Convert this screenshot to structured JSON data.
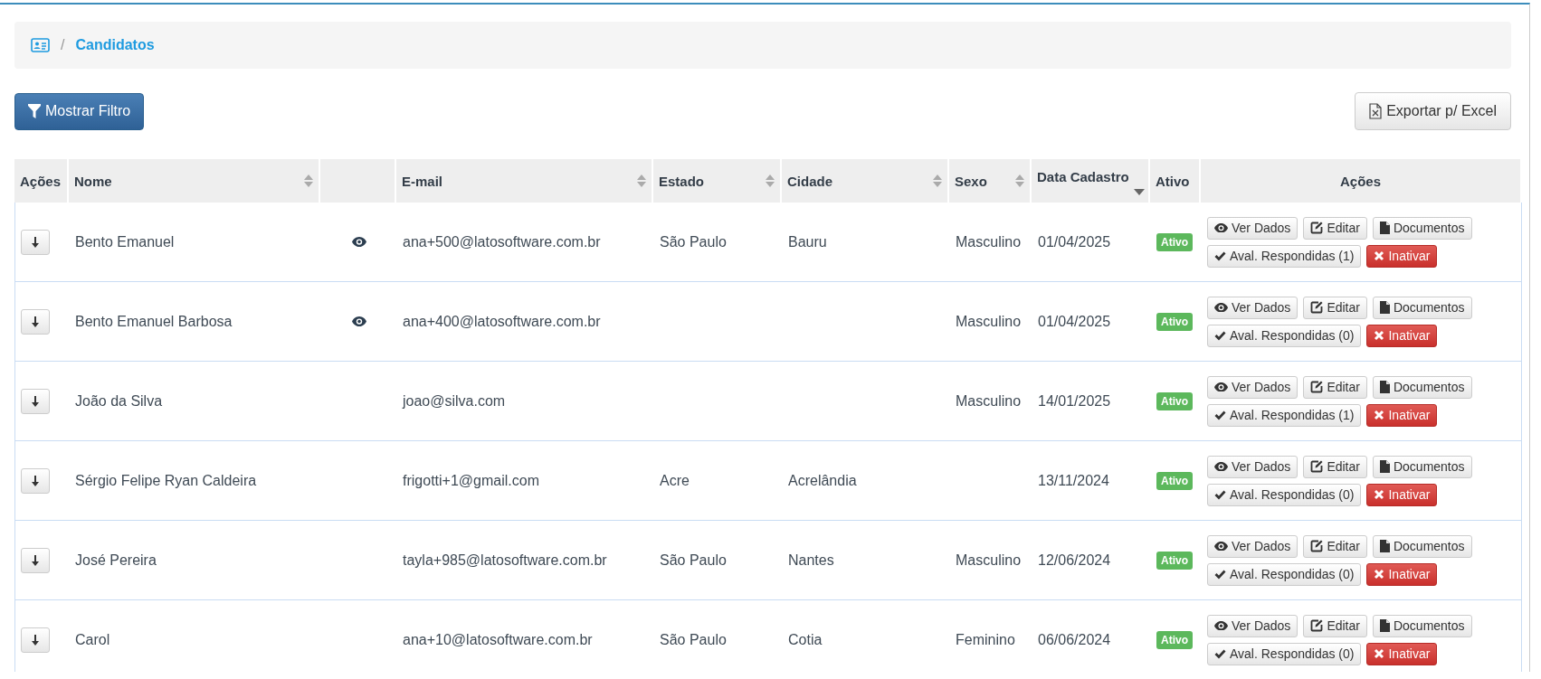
{
  "breadcrumb": {
    "separator": "/",
    "current": "Candidatos"
  },
  "toolbar": {
    "filter_button": "Mostrar Filtro",
    "export_button": "Exportar p/ Excel"
  },
  "table": {
    "columns": [
      {
        "label": "Ações",
        "sortable": false
      },
      {
        "label": "Nome",
        "sortable": true,
        "sorted_desc": false
      },
      {
        "sortable": false
      },
      {
        "label": "E-mail",
        "sortable": true,
        "sorted_desc": false
      },
      {
        "label": "Estado",
        "sortable": true,
        "sorted_desc": false
      },
      {
        "label": "Cidade",
        "sortable": true,
        "sorted_desc": false
      },
      {
        "label": "Sexo",
        "sortable": true,
        "sorted_desc": false
      },
      {
        "label": "Data Cadastro",
        "sortable": true,
        "sorted_desc": true
      },
      {
        "label": "Ativo",
        "sortable": false
      },
      {
        "label": "Ações",
        "sortable": false
      }
    ],
    "rows": [
      {
        "name": "Bento Emanuel",
        "viewed": true,
        "email": "ana+500@latosoftware.com.br",
        "estado": "São Paulo",
        "cidade": "Bauru",
        "sexo": "Masculino",
        "data": "01/04/2025",
        "status": "Ativo",
        "active": true,
        "actions": {
          "view": "Ver Dados",
          "edit": "Editar",
          "docs": "Documentos",
          "answered": "Aval. Respondidas (1)",
          "deactivate": "Inativar"
        }
      },
      {
        "name": "Bento Emanuel Barbosa",
        "viewed": true,
        "email": "ana+400@latosoftware.com.br",
        "estado": "",
        "cidade": "",
        "sexo": "Masculino",
        "data": "01/04/2025",
        "status": "Ativo",
        "active": true,
        "actions": {
          "view": "Ver Dados",
          "edit": "Editar",
          "docs": "Documentos",
          "answered": "Aval. Respondidas (0)",
          "deactivate": "Inativar"
        }
      },
      {
        "name": "João da Silva",
        "viewed": false,
        "email": "joao@silva.com",
        "estado": "",
        "cidade": "",
        "sexo": "Masculino",
        "data": "14/01/2025",
        "status": "Ativo",
        "active": true,
        "actions": {
          "view": "Ver Dados",
          "edit": "Editar",
          "docs": "Documentos",
          "answered": "Aval. Respondidas (1)",
          "deactivate": "Inativar"
        }
      },
      {
        "name": "Sérgio Felipe Ryan Caldeira",
        "viewed": false,
        "email": "frigotti+1@gmail.com",
        "estado": "Acre",
        "cidade": "Acrelândia",
        "sexo": "",
        "data": "13/11/2024",
        "status": "Ativo",
        "active": true,
        "actions": {
          "view": "Ver Dados",
          "edit": "Editar",
          "docs": "Documentos",
          "answered": "Aval. Respondidas (0)",
          "deactivate": "Inativar"
        }
      },
      {
        "name": "José Pereira",
        "viewed": false,
        "email": "tayla+985@latosoftware.com.br",
        "estado": "São Paulo",
        "cidade": "Nantes",
        "sexo": "Masculino",
        "data": "12/06/2024",
        "status": "Ativo",
        "active": true,
        "actions": {
          "view": "Ver Dados",
          "edit": "Editar",
          "docs": "Documentos",
          "answered": "Aval. Respondidas (0)",
          "deactivate": "Inativar"
        }
      },
      {
        "name": "Carol",
        "viewed": false,
        "email": "ana+10@latosoftware.com.br",
        "estado": "São Paulo",
        "cidade": "Cotia",
        "sexo": "Feminino",
        "data": "06/06/2024",
        "status": "Ativo",
        "active": true,
        "actions": {
          "view": "Ver Dados",
          "edit": "Editar",
          "docs": "Documentos",
          "answered": "Aval. Respondidas (0)",
          "deactivate": "Inativar"
        }
      }
    ]
  }
}
